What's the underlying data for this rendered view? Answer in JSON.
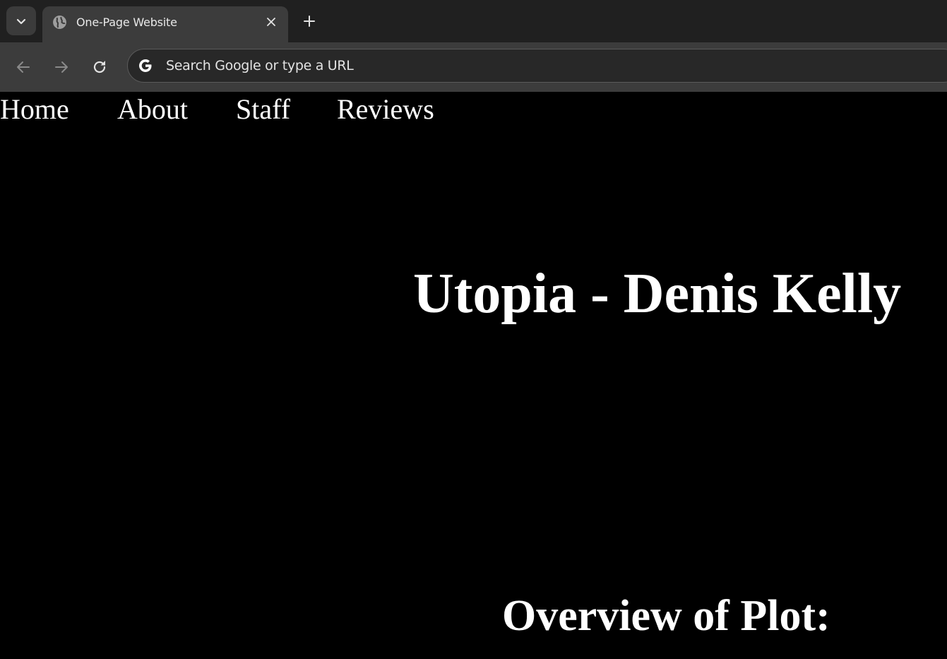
{
  "browser": {
    "tab": {
      "title": "One-Page Website"
    },
    "omnibox": {
      "placeholder": "Search Google or type a URL"
    },
    "icons": [
      "tab-search-icon",
      "globe-icon",
      "close-icon",
      "plus-icon",
      "back-arrow-icon",
      "forward-arrow-icon",
      "reload-icon",
      "google-g-icon"
    ]
  },
  "site": {
    "nav": {
      "home": "Home",
      "about": "About",
      "staff": "Staff",
      "reviews": "Reviews"
    },
    "title": "Utopia - Denis Kelly",
    "section_heading": "Overview of Plot:"
  },
  "colors": {
    "page_background": "#000000",
    "page_text": "#ffffff",
    "chrome_dark": "#202020",
    "chrome_mid": "#3c3c3c"
  }
}
